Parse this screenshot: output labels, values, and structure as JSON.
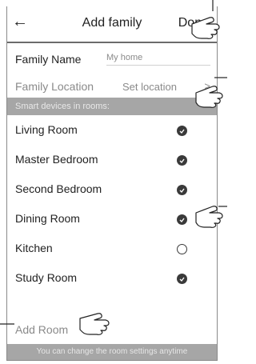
{
  "header": {
    "back_icon": "left-arrow-icon",
    "title": "Add family",
    "done_label": "Done"
  },
  "family_name": {
    "label": "Family Name",
    "placeholder": "My home"
  },
  "family_location": {
    "label": "Family Location",
    "value": "Set location",
    "chevron": ">"
  },
  "rooms_section_title": "Smart devices in rooms:",
  "rooms": [
    {
      "label": "Living Room",
      "selected": true
    },
    {
      "label": "Master Bedroom",
      "selected": true
    },
    {
      "label": "Second Bedroom",
      "selected": true
    },
    {
      "label": "Dining Room",
      "selected": true
    },
    {
      "label": "Kitchen",
      "selected": false
    },
    {
      "label": "Study Room",
      "selected": true
    }
  ],
  "add_room_label": "Add Room",
  "footer_note": "You can change the room settings anytime",
  "colors": {
    "band": "#a6a6a6",
    "check": "#3a3a3a",
    "muted": "#8a8a8a"
  }
}
